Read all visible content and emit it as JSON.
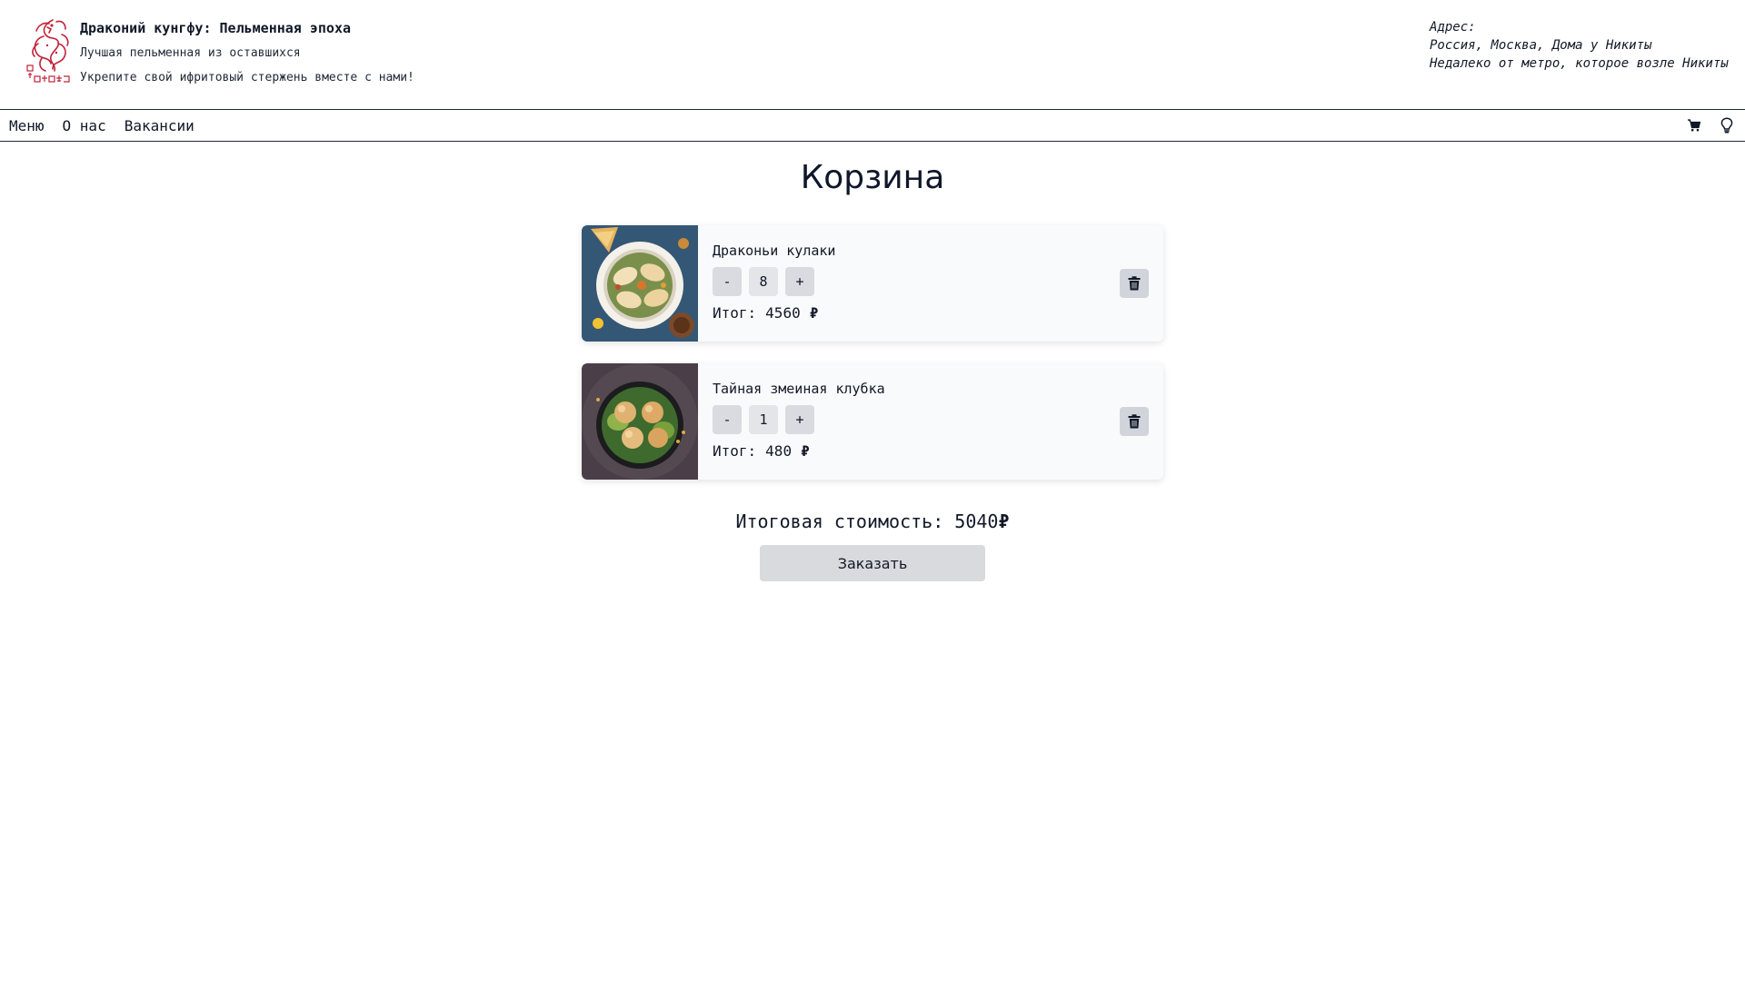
{
  "header": {
    "title": "Драконий кунгфу: Пельменная эпоха",
    "subtitle": "Лучшая пельменная из оставшихся",
    "slogan": "Укрепите свой ифритовый стержень вместе с нами!",
    "address_label": "Адрес:",
    "address_line1": "Россия, Москва, Дома у Никиты",
    "address_line2": "Недалеко от метро, которое возле Никиты"
  },
  "nav": {
    "items": [
      {
        "label": "Меню"
      },
      {
        "label": "О нас"
      },
      {
        "label": "Вакансии"
      }
    ],
    "icons": [
      "cart-icon",
      "lightbulb-icon"
    ]
  },
  "page": {
    "title": "Корзина"
  },
  "cart": {
    "items": [
      {
        "name": "Драконьи кулаки",
        "quantity": "8",
        "total_label": "Итог:",
        "total": "4560",
        "currency": "₽",
        "image": "dumplings-bowl-icon"
      },
      {
        "name": "Тайная змеиная клубка",
        "quantity": "1",
        "total_label": "Итог:",
        "total": "480",
        "currency": "₽",
        "image": "dumplings-plate-icon"
      }
    ],
    "minus_label": "-",
    "plus_label": "+",
    "grand_total_label": "Итоговая стоимость:",
    "grand_total": "5040",
    "currency": "₽",
    "order_button": "Заказать"
  },
  "colors": {
    "logo_red": "#c0233a",
    "card_bg": "#f9fafb",
    "button_bg": "#d9dade",
    "text": "#111827"
  }
}
